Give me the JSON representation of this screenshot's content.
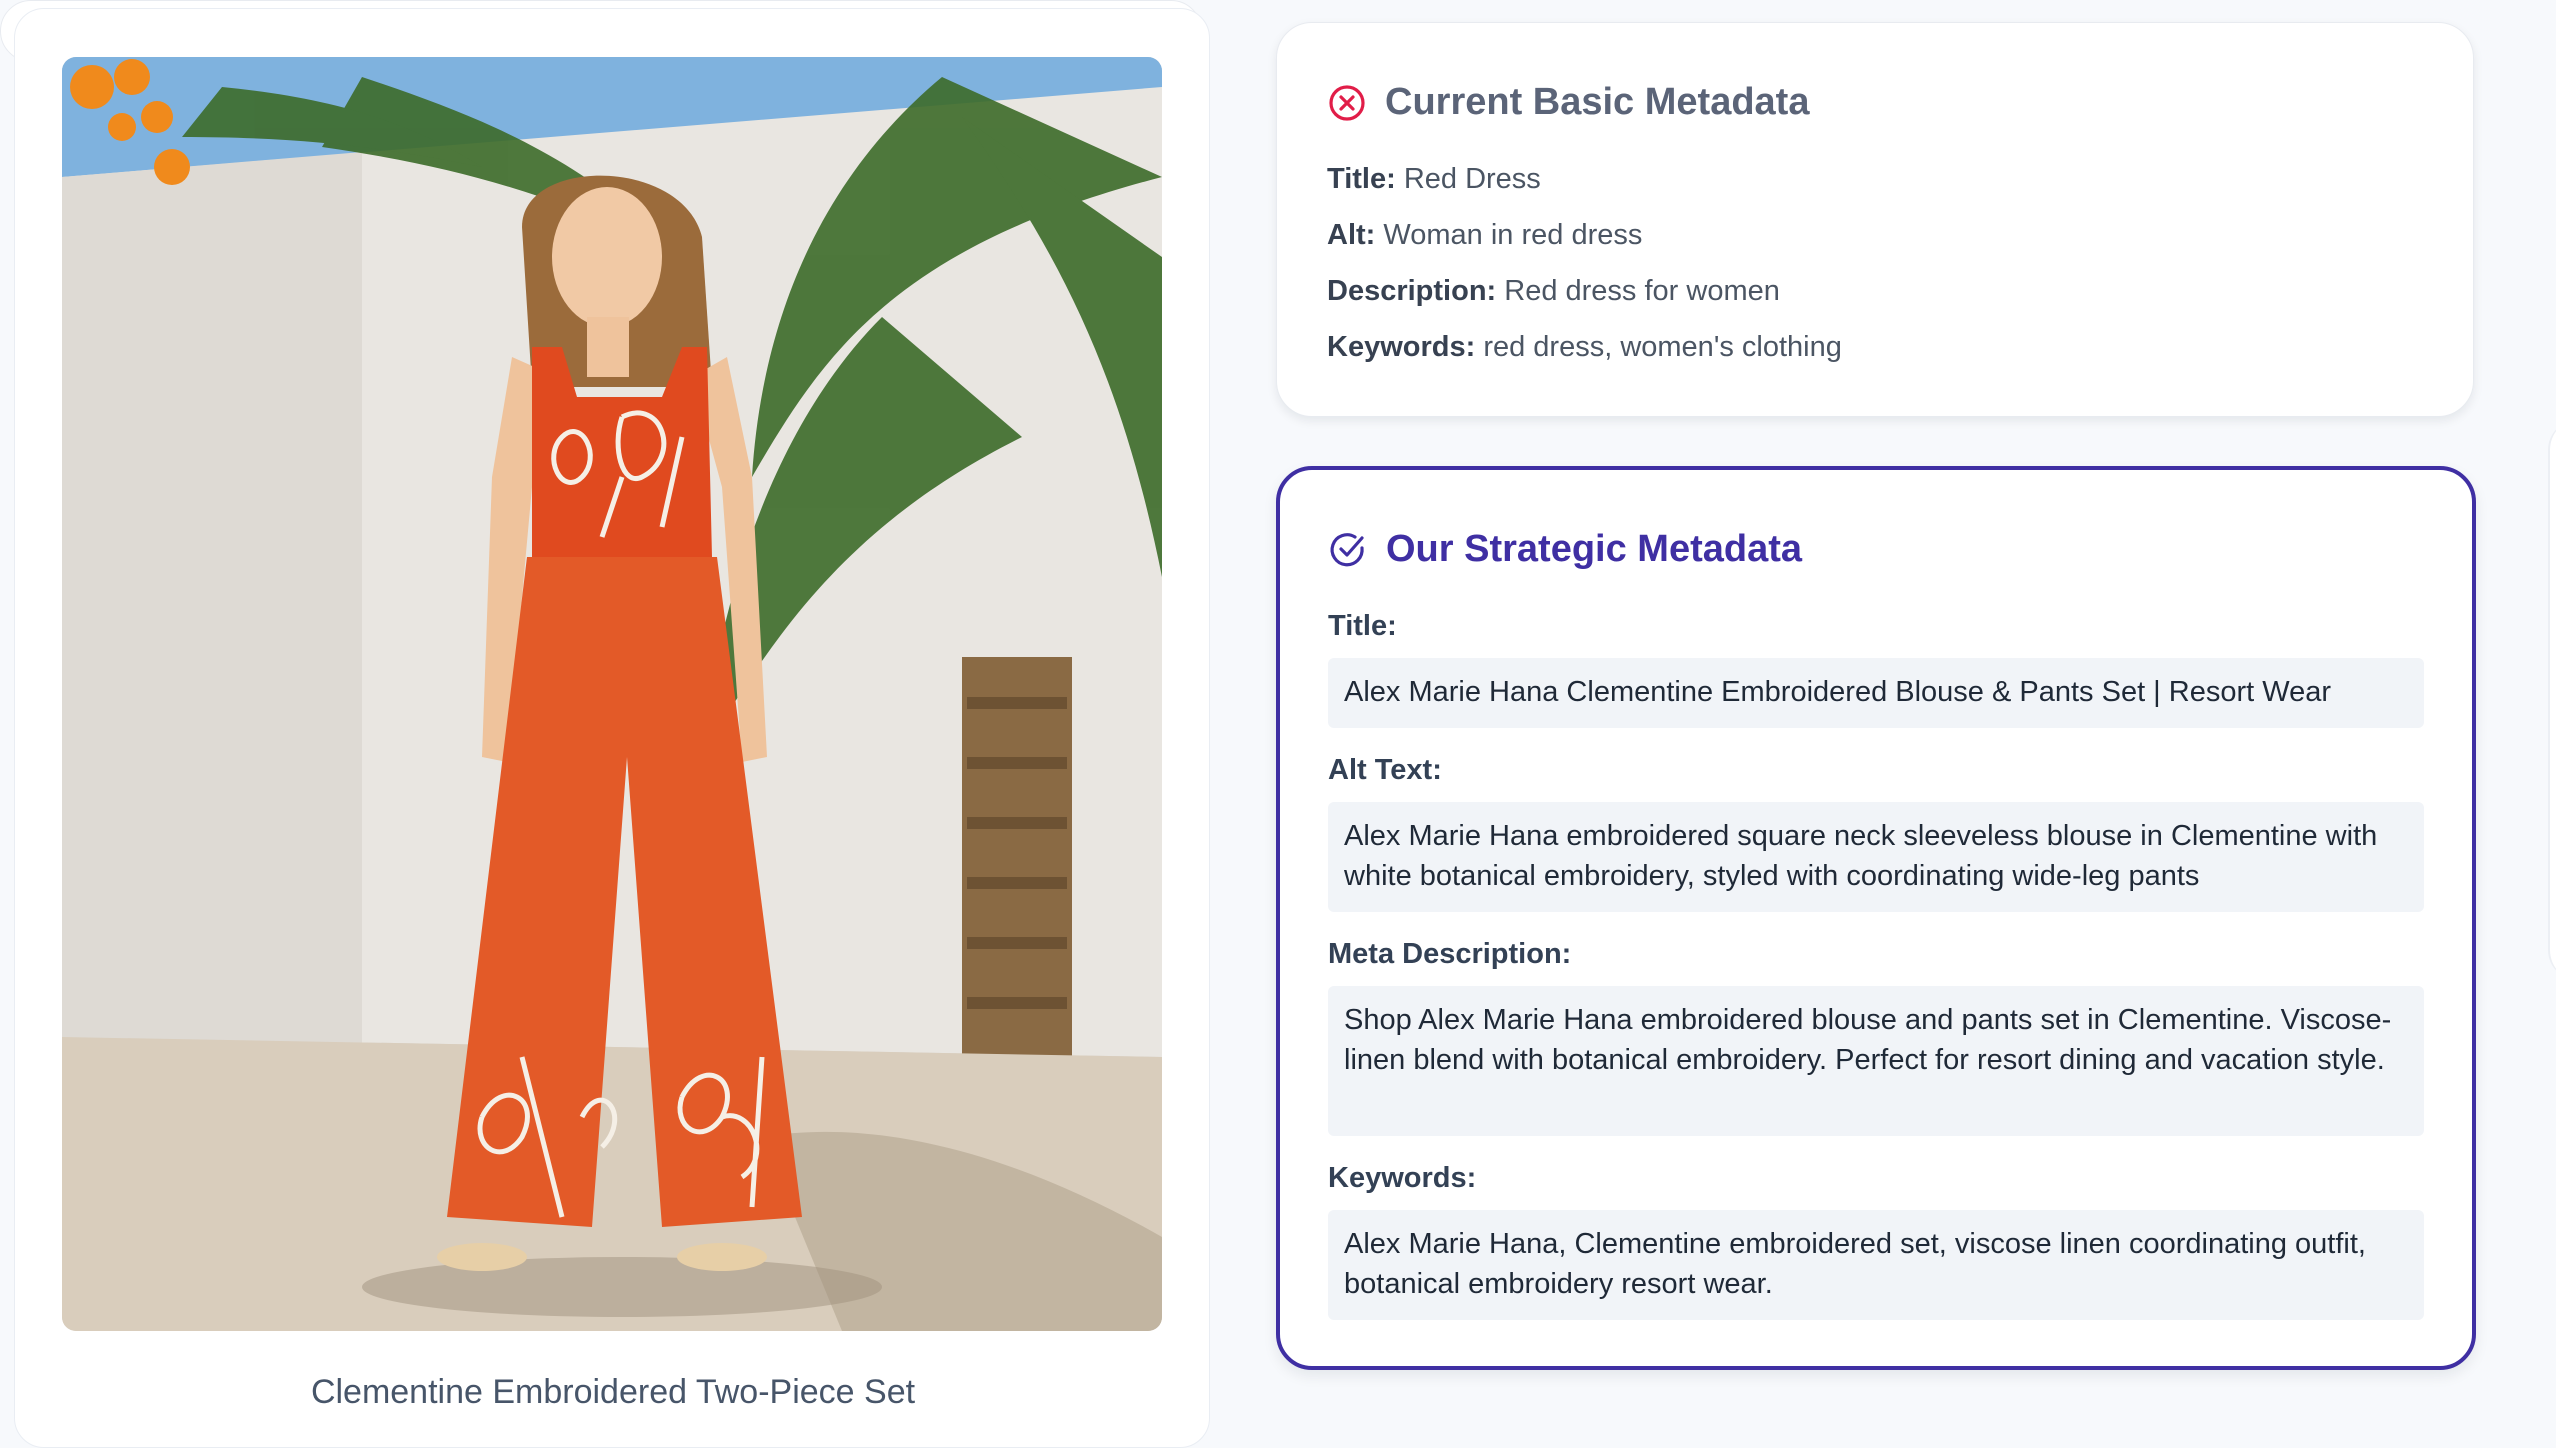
{
  "product": {
    "caption": "Clementine Embroidered Two-Piece Set",
    "photo_alt": "Woman wearing orange embroidered sleeveless top and wide-leg pants in front of a white wall with palm fronds"
  },
  "current": {
    "heading": "Current Basic Metadata",
    "icon": "x-circle-icon",
    "accent": "#e11d48",
    "fields": [
      {
        "label": "Title:",
        "value": "Red Dress"
      },
      {
        "label": "Alt:",
        "value": "Woman in red dress"
      },
      {
        "label": "Description:",
        "value": "Red dress for women"
      },
      {
        "label": "Keywords:",
        "value": "red dress, women's clothing"
      }
    ]
  },
  "strategic": {
    "heading": "Our Strategic Metadata",
    "icon": "check-circle-icon",
    "accent": "#3f2fa3",
    "fields": [
      {
        "label": "Title:",
        "value": "Alex Marie Hana Clementine Embroidered Blouse & Pants Set | Resort Wear"
      },
      {
        "label": "Alt Text:",
        "value": "Alex Marie Hana embroidered square neck sleeveless blouse in Clementine with white botanical embroidery, styled with coordinating wide-leg pants"
      },
      {
        "label": "Meta Description:",
        "value": "Shop Alex Marie Hana embroidered blouse and pants set in Clementine. Viscose-linen blend with botanical embroidery. Perfect for resort dining and vacation style."
      },
      {
        "label": "Keywords:",
        "value": "Alex Marie Hana, Clementine embroidered set, viscose linen coordinating outfit, botanical embroidery resort wear."
      }
    ]
  }
}
